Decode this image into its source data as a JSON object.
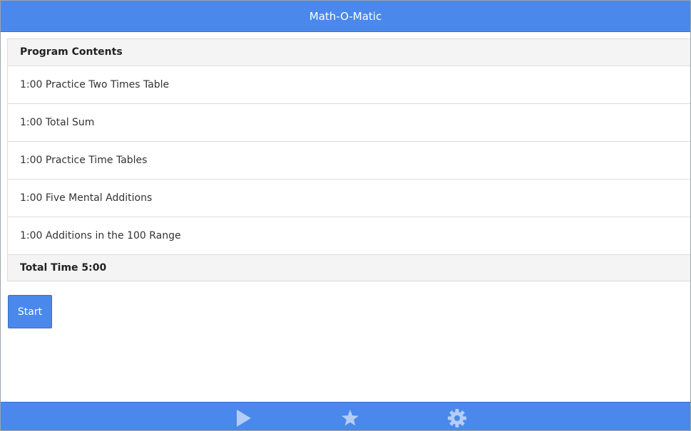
{
  "app": {
    "title": "Math-O-Matic"
  },
  "program": {
    "header": "Program Contents",
    "items": [
      {
        "label": "1:00 Practice Two Times Table"
      },
      {
        "label": "1:00 Total Sum"
      },
      {
        "label": "1:00 Practice Time Tables"
      },
      {
        "label": "1:00 Five Mental Additions"
      },
      {
        "label": "1:00 Additions in the 100 Range"
      }
    ],
    "total": "Total Time 5:00"
  },
  "actions": {
    "start_label": "Start"
  },
  "tabbar": {
    "tabs": [
      {
        "icon": "play-icon"
      },
      {
        "icon": "star-icon"
      },
      {
        "icon": "gear-icon"
      }
    ]
  },
  "colors": {
    "accent": "#4a88ec",
    "tab_icon": "#b3cdf6"
  }
}
